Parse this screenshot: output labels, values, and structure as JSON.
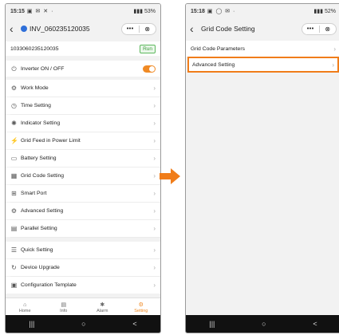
{
  "left": {
    "status": {
      "time": "15:15",
      "left_icons": "▣ ✉ ✕ ·",
      "battery": "53%"
    },
    "header": {
      "title": "INV_060235120035",
      "capsule_more": "•••",
      "capsule_close": "⊗"
    },
    "serial": "1033060235120035",
    "run_badge": "Run",
    "inverter_toggle_label": "Inverter ON / OFF",
    "menu": [
      {
        "label": "Work Mode",
        "icon": "⚙"
      },
      {
        "label": "Time Setting",
        "icon": "◷"
      },
      {
        "label": "Indicator Setting",
        "icon": "✺"
      },
      {
        "label": "Grid Feed in Power Limit",
        "icon": "⚡"
      },
      {
        "label": "Battery Setting",
        "icon": "▭"
      },
      {
        "label": "Grid Code Setting",
        "icon": "▦"
      },
      {
        "label": "Smart Port",
        "icon": "⊞"
      },
      {
        "label": "Advanced Setting",
        "icon": "⚙"
      },
      {
        "label": "Parallel Setting",
        "icon": "▤"
      },
      {
        "label": "Quick Setting",
        "icon": "☰"
      },
      {
        "label": "Device Upgrade",
        "icon": "↻"
      },
      {
        "label": "Configuration Template",
        "icon": "▣"
      }
    ],
    "tabs": [
      {
        "label": "Home",
        "icon": "⌂"
      },
      {
        "label": "Info",
        "icon": "▤"
      },
      {
        "label": "Alarm",
        "icon": "✱"
      },
      {
        "label": "Setting",
        "icon": "⚙"
      }
    ],
    "nav": {
      "recent": "|||",
      "home": "○",
      "back": "<"
    }
  },
  "right": {
    "status": {
      "time": "15:18",
      "left_icons": "▣ ◯ ✉ ·",
      "battery": "52%"
    },
    "header": {
      "title": "Grid Code Setting",
      "capsule_more": "•••",
      "capsule_close": "⊗"
    },
    "items": [
      {
        "label": "Grid Code Parameters"
      },
      {
        "label": "Advanced Setting"
      }
    ],
    "nav": {
      "recent": "|||",
      "home": "○",
      "back": "<"
    }
  },
  "colors": {
    "accent": "#f08a24",
    "highlight": "#f07d1a",
    "run_green": "#5cb85c"
  }
}
